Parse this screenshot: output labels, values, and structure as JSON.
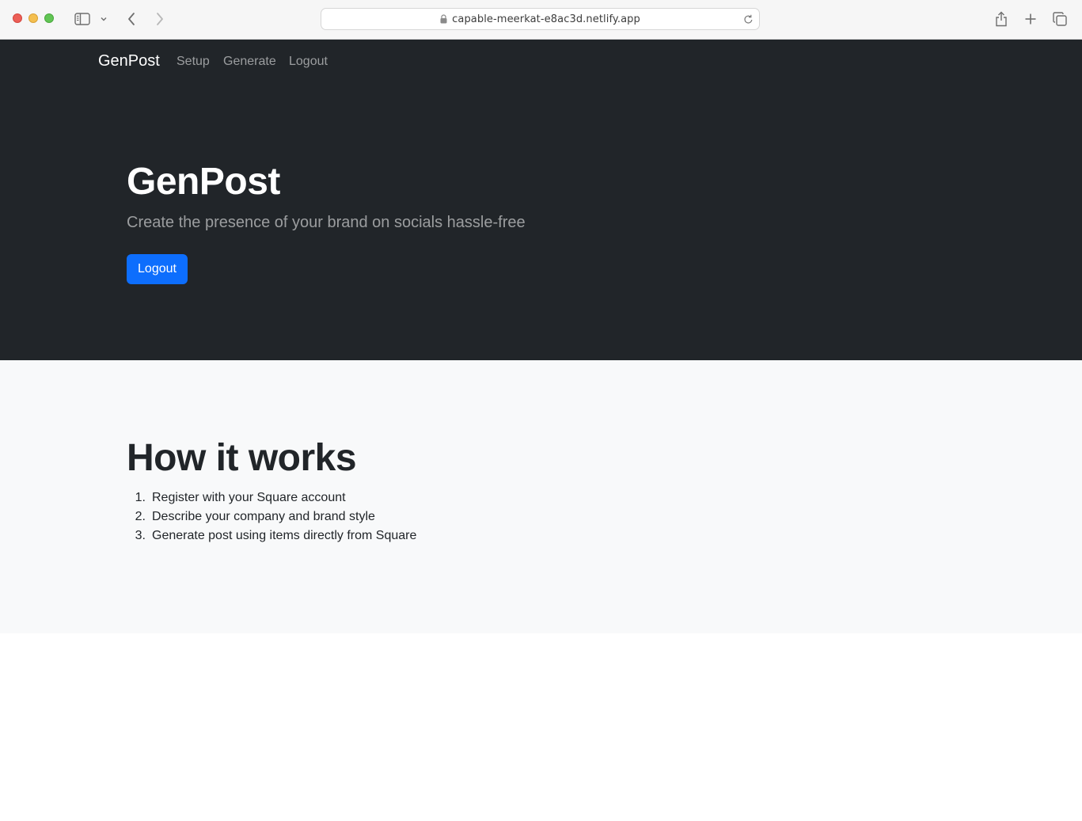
{
  "browser": {
    "url": "capable-meerkat-e8ac3d.netlify.app",
    "icons": {
      "sidebar": "sidebar-icon",
      "chevron": "chevron-down-icon",
      "back": "back-arrow-icon",
      "forward": "forward-arrow-icon",
      "lock": "lock-icon",
      "reload": "reload-icon",
      "share": "share-icon",
      "new_tab": "plus-icon",
      "tabs": "tab-overview-icon"
    }
  },
  "navbar": {
    "brand": "GenPost",
    "links": [
      {
        "label": "Setup"
      },
      {
        "label": "Generate"
      },
      {
        "label": "Logout"
      }
    ]
  },
  "hero": {
    "title": "GenPost",
    "subtitle": "Create the presence of your brand on socials hassle-free",
    "button_label": "Logout"
  },
  "how_it_works": {
    "title": "How it works",
    "steps": [
      {
        "number": "1.",
        "text": "Register with your Square account"
      },
      {
        "number": "2.",
        "text": "Describe your company and brand style"
      },
      {
        "number": "3.",
        "text": "Generate post using items directly from Square"
      }
    ]
  },
  "colors": {
    "dark_bg": "#212529",
    "primary": "#0d6efd",
    "light_bg": "#f8f9fa"
  }
}
